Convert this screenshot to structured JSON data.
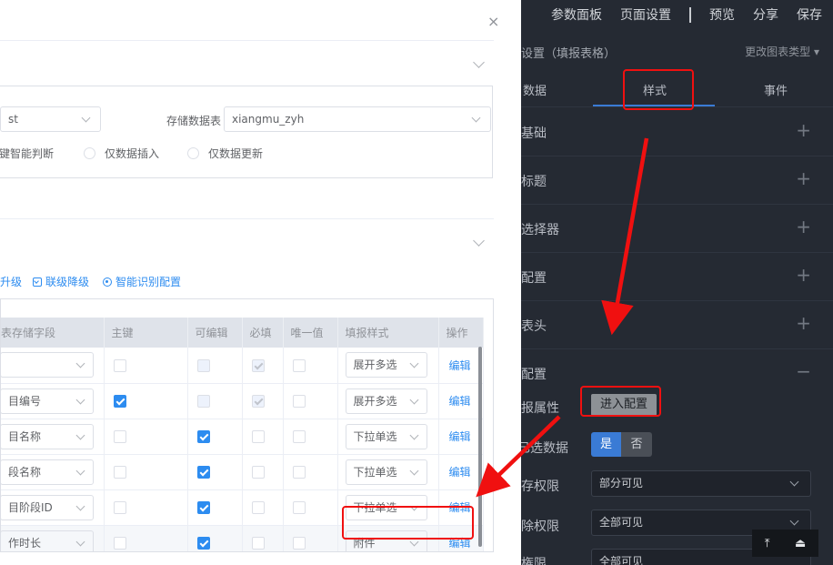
{
  "dialog": {
    "close_glyph": "×",
    "source_select_value": "st",
    "storage_table_label": "存储数据表",
    "storage_table_value": "xiangmu_zyh",
    "radio_options": [
      "键智能判断",
      "仅数据插入",
      "仅数据更新"
    ],
    "toolbar": {
      "upgrade_label": "升级",
      "downgrade_label": "联级降级",
      "smart_config_label": "智能识别配置"
    },
    "table": {
      "headers": [
        "表存储字段",
        "主键",
        "可编辑",
        "必填",
        "唯一值",
        "填报样式",
        "操作"
      ],
      "rows": [
        {
          "field": "",
          "style": "展开多选",
          "action": "编辑",
          "primary": "off",
          "editable": "dis",
          "required": "dis-on",
          "unique": "off"
        },
        {
          "field": "目编号",
          "style": "展开多选",
          "action": "编辑",
          "primary": "on",
          "editable": "dis",
          "required": "dis-on",
          "unique": "off"
        },
        {
          "field": "目名称",
          "style": "下拉单选",
          "action": "编辑",
          "primary": "off",
          "editable": "on",
          "required": "off",
          "unique": "off"
        },
        {
          "field": "段名称",
          "style": "下拉单选",
          "action": "编辑",
          "primary": "off",
          "editable": "on",
          "required": "off",
          "unique": "off"
        },
        {
          "field": "目阶段ID",
          "style": "下拉单选",
          "action": "编辑",
          "primary": "off",
          "editable": "on",
          "required": "off",
          "unique": "off"
        },
        {
          "field": "作时长",
          "style": "附件",
          "action": "编辑",
          "primary": "off",
          "editable": "on",
          "required": "off",
          "unique": "off"
        }
      ]
    }
  },
  "panel": {
    "topbar": [
      "参数面板",
      "页面设置",
      "预览",
      "分享",
      "保存"
    ],
    "title": "设置（填报表格）",
    "change_chart_type": "更改图表类型 ▾",
    "tabs": [
      "数据",
      "样式",
      "事件"
    ],
    "accordions": [
      {
        "label": "基础",
        "sign": "+"
      },
      {
        "label": "标题",
        "sign": "+"
      },
      {
        "label": "选择器",
        "sign": "+"
      },
      {
        "label": "配置",
        "sign": "+"
      },
      {
        "label": "表头",
        "sign": "+"
      },
      {
        "label": "配置",
        "sign": "−"
      }
    ],
    "report_attr_label": "报属性",
    "enter_config_label": "进入配置",
    "selected_data_label": "已选数据",
    "toggle_yes": "是",
    "toggle_no": "否",
    "storage_perm_label": "存权限",
    "storage_perm_value": "部分可见",
    "delete_perm_label": "除权限",
    "delete_perm_value": "全部可见",
    "third_perm_label": "権限",
    "third_perm_value": "全部可见",
    "float_icons": [
      "to-top-icon",
      "eject-icon"
    ]
  },
  "colors": {
    "accent": "#2d8cf0",
    "panel_bg": "#252a33",
    "annotation_red": "#f01010",
    "toggle_active": "#3a7bd5"
  }
}
